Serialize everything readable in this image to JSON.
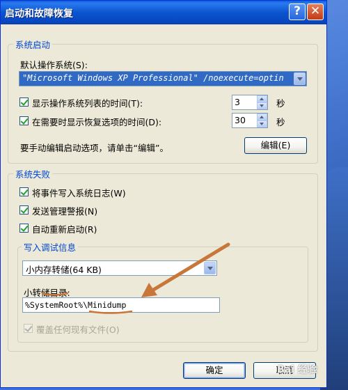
{
  "window": {
    "title": "启动和故障恢复",
    "help_glyph": "?",
    "close_glyph": "✕"
  },
  "startup": {
    "group_label": "系统启动",
    "default_os_label": "默认操作系统(S):",
    "default_os_value": "\"Microsoft Windows XP Professional\" /noexecute=optin",
    "show_list_label": "显示操作系统列表的时间(T):",
    "show_list_value": "3",
    "show_recovery_label": "在需要时显示恢复选项的时间(D):",
    "show_recovery_value": "30",
    "unit_seconds": "秒",
    "edit_hint": "要手动编辑启动选项，请单击“编辑”。",
    "edit_button": "编辑(E)"
  },
  "failure": {
    "group_label": "系统失败",
    "write_event_label": "将事件写入系统日志(W)",
    "send_alert_label": "发送管理警报(N)",
    "auto_restart_label": "自动重新启动(R)",
    "debug": {
      "group_label": "写入调试信息",
      "dump_type_value": "小内存转储(64 KB)",
      "small_dump_dir_label": "小转储目录:",
      "small_dump_dir_value": "%SystemRoot%\\Minidump",
      "overwrite_label": "覆盖任何现有文件(O)"
    }
  },
  "footer": {
    "ok_button": "确定",
    "cancel_button": "取消"
  },
  "watermark": "Bai 经验",
  "colors": {
    "title_bar": "#0a55cf",
    "group_label": "#0046d5",
    "annotation_arrow": "#c8763a",
    "selection": "#316ac5"
  }
}
